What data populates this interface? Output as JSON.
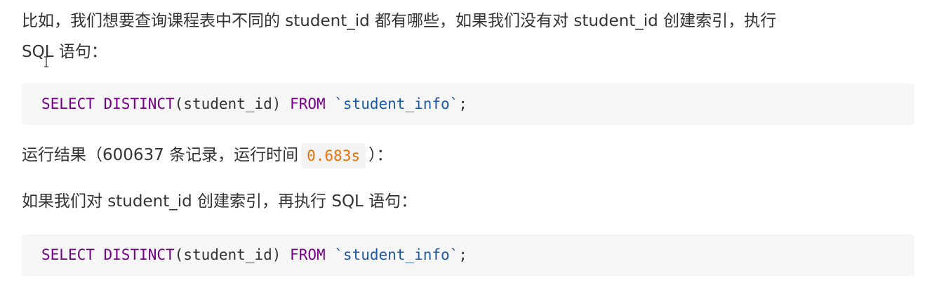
{
  "paragraph1": {
    "line1": "比如，我们想要查询课程表中不同的 student_id 都有哪些，如果我们没有对 student_id 创建索引，执行",
    "line2": "SQL 语句："
  },
  "code_block_1": {
    "kw_select": "SELECT",
    "kw_distinct": "DISTINCT",
    "args": "(student_id)",
    "kw_from": "FROM",
    "table": "`student_info`",
    "terminator": ";"
  },
  "paragraph2": {
    "prefix": "运行结果（600637 条记录，运行时间",
    "time": "0.683s",
    "suffix": "）："
  },
  "paragraph3": {
    "text": "如果我们对 student_id 创建索引，再执行 SQL 语句："
  },
  "code_block_2": {
    "kw_select": "SELECT",
    "kw_distinct": "DISTINCT",
    "args": "(student_id)",
    "kw_from": "FROM",
    "table": "`student_info`",
    "terminator": ";"
  },
  "colors": {
    "keyword": "#770088",
    "string": "#1c5aa8",
    "inline_code": "#e8710a",
    "text": "#333333",
    "code_background": "#f6f6f6"
  },
  "icons": {
    "cursor": "text-cursor-icon"
  }
}
